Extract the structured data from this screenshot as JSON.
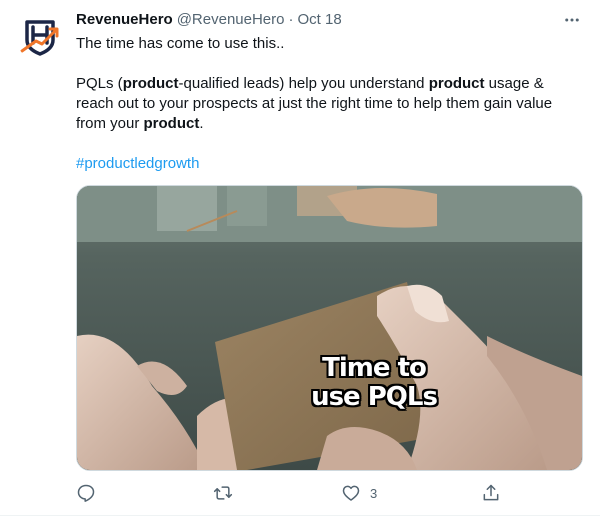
{
  "tweet": {
    "author_name": "RevenueHero",
    "handle": "@RevenueHero",
    "separator": "·",
    "date": "Oct 18",
    "line1": "The time has come to use this..",
    "para2": [
      {
        "text": "PQLs (",
        "bold": false
      },
      {
        "text": "product",
        "bold": true
      },
      {
        "text": "-qualified leads) help you understand ",
        "bold": false
      },
      {
        "text": "product",
        "bold": true
      },
      {
        "text": " usage & reach out to your prospects at just the right time to help them gain value from your ",
        "bold": false
      },
      {
        "text": "product",
        "bold": true
      },
      {
        "text": ".",
        "bold": false
      }
    ],
    "hashtag": "#productledgrowth",
    "media_caption": "Time to use PQLs",
    "like_count": "3"
  },
  "icons": {
    "avatar": "revenuehero-logo",
    "more": "more-horizontal-icon",
    "reply": "reply-icon",
    "retweet": "retweet-icon",
    "like": "heart-icon",
    "share": "share-icon"
  },
  "colors": {
    "text": "#0f1419",
    "secondary": "#536471",
    "link": "#1d9bf0",
    "logo_navy": "#1c2646",
    "logo_orange": "#f0762a"
  }
}
